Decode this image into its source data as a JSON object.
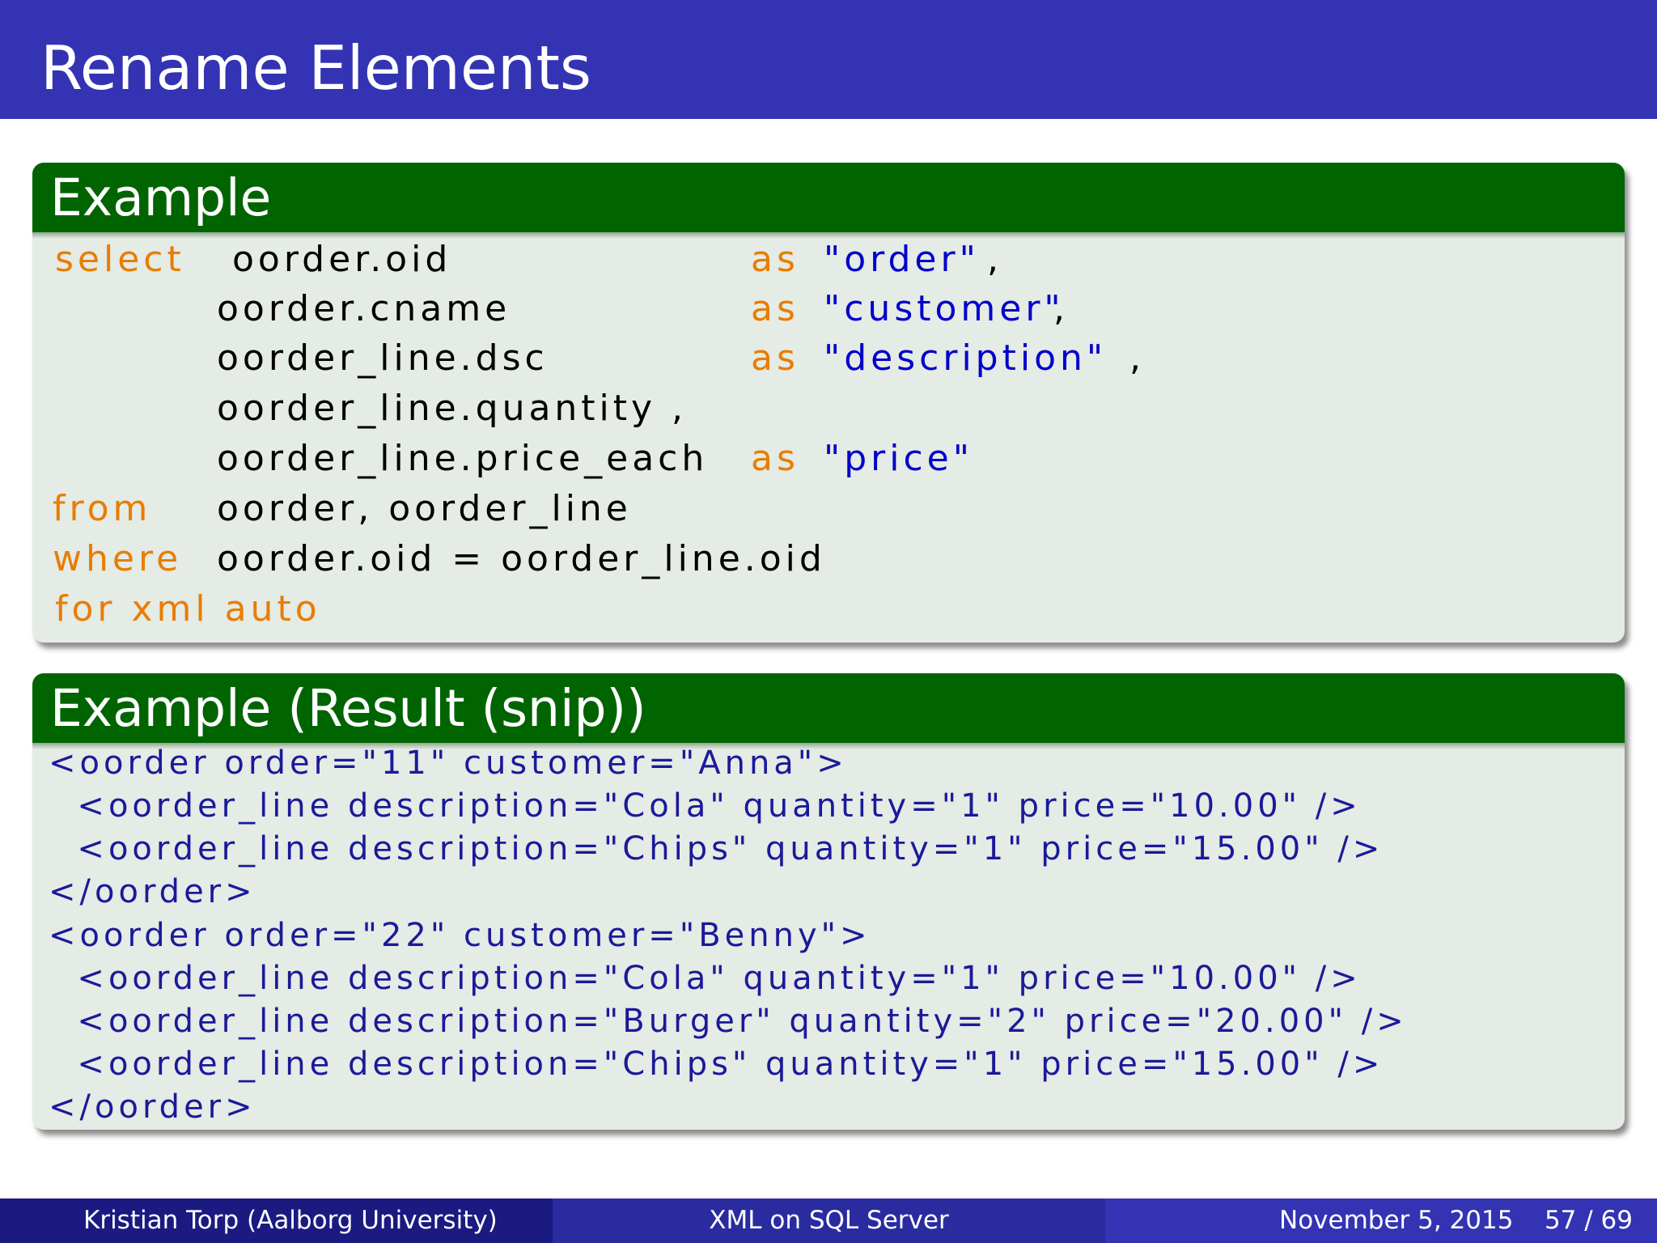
{
  "slide": {
    "title": "Rename Elements"
  },
  "example_block": {
    "title": "Example",
    "lines": [
      [
        [
          "kw",
          "select"
        ],
        [
          "t",
          " oorder.oid"
        ],
        [
          "kw",
          "as"
        ],
        [
          "str",
          "\"order\""
        ],
        [
          "t",
          ","
        ]
      ],
      [
        [
          "t",
          "oorder.cname"
        ],
        [
          "kw",
          "as"
        ],
        [
          "str",
          "\"customer\""
        ],
        [
          "t",
          ","
        ]
      ],
      [
        [
          "t",
          "oorder_line.dsc"
        ],
        [
          "kw",
          "as"
        ],
        [
          "str",
          "\"description\""
        ],
        [
          "t",
          ","
        ]
      ],
      [
        [
          "t",
          "oorder_line.quantity ,"
        ]
      ],
      [
        [
          "t",
          "oorder_line.price_each"
        ],
        [
          "kw",
          "as"
        ],
        [
          "str",
          "\"price\""
        ]
      ],
      [
        [
          "kw",
          "from"
        ],
        [
          "t",
          "oorder, oorder_line"
        ]
      ],
      [
        [
          "kw",
          "where"
        ],
        [
          "t",
          "oorder.oid = oorder_line.oid"
        ]
      ],
      [
        [
          "kw",
          "for xml auto"
        ]
      ]
    ]
  },
  "result_block": {
    "title": "Example (Result (snip))",
    "lines": [
      "<oorder order=\"11\" customer=\"Anna\">",
      "  <oorder_line description=\"Cola\" quantity=\"1\" price=\"10.00\" />",
      "  <oorder_line description=\"Chips\" quantity=\"1\" price=\"15.00\" />",
      "</oorder>",
      "<oorder order=\"22\" customer=\"Benny\">",
      "  <oorder_line description=\"Cola\" quantity=\"1\" price=\"10.00\" />",
      "  <oorder_line description=\"Burger\" quantity=\"2\" price=\"20.00\" />",
      "  <oorder_line description=\"Chips\" quantity=\"1\" price=\"15.00\" />",
      "</oorder>"
    ]
  },
  "footer": {
    "author": "Kristian Torp  (Aalborg University)",
    "course": "XML on SQL Server",
    "date": "November 5, 2015",
    "page": "57 / 69"
  },
  "colors": {
    "header": "#3333b3",
    "block_title": "#006400",
    "block_body": "#e5ebe5",
    "keyword": "#e87d00",
    "string": "#0000cc"
  }
}
